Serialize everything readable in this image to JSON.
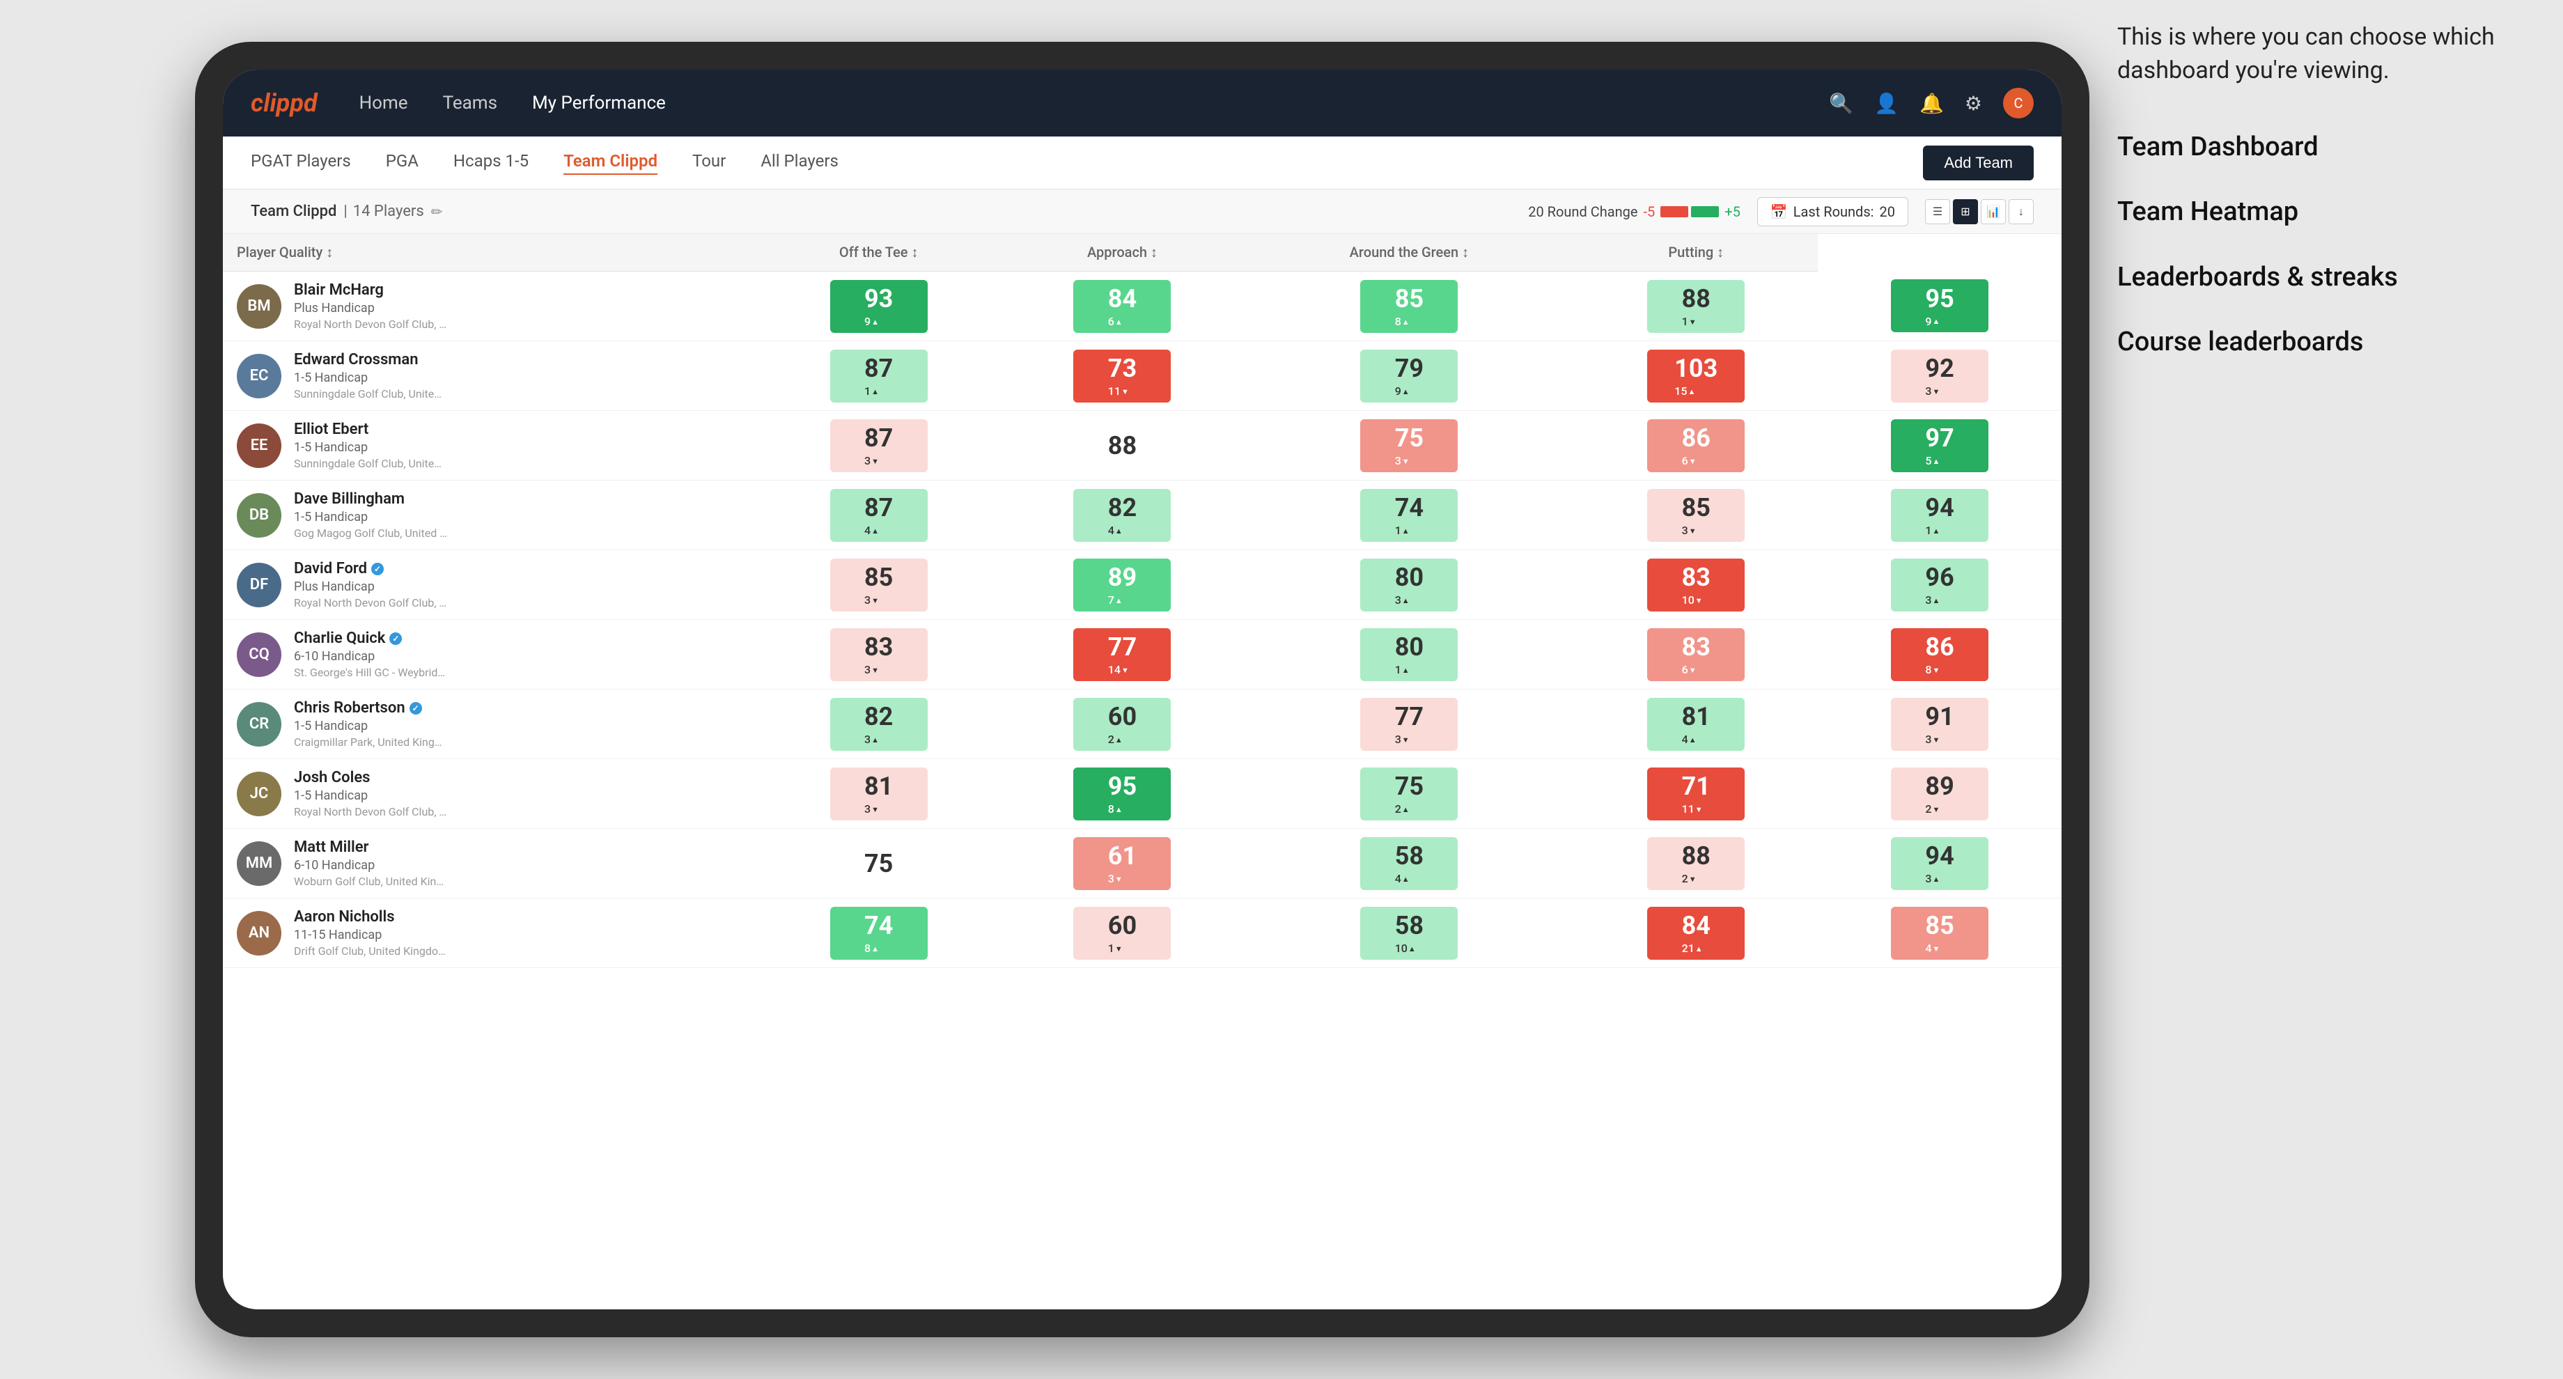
{
  "annotation": {
    "text": "This is where you can choose which dashboard you're viewing.",
    "items": [
      "Team Dashboard",
      "Team Heatmap",
      "Leaderboards & streaks",
      "Course leaderboards"
    ]
  },
  "nav": {
    "logo": "clippd",
    "links": [
      "Home",
      "Teams",
      "My Performance"
    ],
    "active_link": "My Performance",
    "icons": [
      "search",
      "user",
      "bell",
      "settings",
      "avatar"
    ]
  },
  "sub_nav": {
    "links": [
      "PGAT Players",
      "PGA",
      "Hcaps 1-5",
      "Team Clippd",
      "Tour",
      "All Players"
    ],
    "active": "Team Clippd",
    "add_button": "Add Team"
  },
  "team_header": {
    "name": "Team Clippd",
    "count": "14 Players",
    "round_change_label": "20 Round Change",
    "round_change_neg": "-5",
    "round_change_pos": "+5",
    "last_rounds_label": "Last Rounds:",
    "last_rounds_value": "20"
  },
  "table": {
    "columns": [
      "Player Quality ↕",
      "Off the Tee ↕",
      "Approach ↕",
      "Around the Green ↕",
      "Putting ↕"
    ],
    "player_col": "Player Quality",
    "rows": [
      {
        "name": "Blair McHarg",
        "handicap": "Plus Handicap",
        "club": "Royal North Devon Golf Club, United Kingdom",
        "avatar_color": "#7b6b4a",
        "initials": "BM",
        "stats": [
          {
            "value": "93",
            "change": "9",
            "dir": "up",
            "color": "green-dark"
          },
          {
            "value": "84",
            "change": "6",
            "dir": "up",
            "color": "green-mid"
          },
          {
            "value": "85",
            "change": "8",
            "dir": "up",
            "color": "green-mid"
          },
          {
            "value": "88",
            "change": "1",
            "dir": "down",
            "color": "green-light"
          },
          {
            "value": "95",
            "change": "9",
            "dir": "up",
            "color": "green-dark"
          }
        ]
      },
      {
        "name": "Edward Crossman",
        "handicap": "1-5 Handicap",
        "club": "Sunningdale Golf Club, United Kingdom",
        "avatar_color": "#5a7a9b",
        "initials": "EC",
        "stats": [
          {
            "value": "87",
            "change": "1",
            "dir": "up",
            "color": "green-light"
          },
          {
            "value": "73",
            "change": "11",
            "dir": "down",
            "color": "red-dark"
          },
          {
            "value": "79",
            "change": "9",
            "dir": "up",
            "color": "green-light"
          },
          {
            "value": "103",
            "change": "15",
            "dir": "up",
            "color": "red-dark"
          },
          {
            "value": "92",
            "change": "3",
            "dir": "down",
            "color": "red-light"
          }
        ]
      },
      {
        "name": "Elliot Ebert",
        "handicap": "1-5 Handicap",
        "club": "Sunningdale Golf Club, United Kingdom",
        "avatar_color": "#8b4a3a",
        "initials": "EE",
        "stats": [
          {
            "value": "87",
            "change": "3",
            "dir": "down",
            "color": "red-light"
          },
          {
            "value": "88",
            "change": "",
            "dir": "",
            "color": "neutral"
          },
          {
            "value": "75",
            "change": "3",
            "dir": "down",
            "color": "red-mid"
          },
          {
            "value": "86",
            "change": "6",
            "dir": "down",
            "color": "red-mid"
          },
          {
            "value": "97",
            "change": "5",
            "dir": "up",
            "color": "green-dark"
          }
        ]
      },
      {
        "name": "Dave Billingham",
        "handicap": "1-5 Handicap",
        "club": "Gog Magog Golf Club, United Kingdom",
        "avatar_color": "#6a8a5a",
        "initials": "DB",
        "stats": [
          {
            "value": "87",
            "change": "4",
            "dir": "up",
            "color": "green-light"
          },
          {
            "value": "82",
            "change": "4",
            "dir": "up",
            "color": "green-light"
          },
          {
            "value": "74",
            "change": "1",
            "dir": "up",
            "color": "green-light"
          },
          {
            "value": "85",
            "change": "3",
            "dir": "down",
            "color": "red-light"
          },
          {
            "value": "94",
            "change": "1",
            "dir": "up",
            "color": "green-light"
          }
        ]
      },
      {
        "name": "David Ford",
        "handicap": "Plus Handicap",
        "club": "Royal North Devon Golf Club, United Kingdom",
        "avatar_color": "#4a6a8a",
        "initials": "DF",
        "verified": true,
        "stats": [
          {
            "value": "85",
            "change": "3",
            "dir": "down",
            "color": "red-light"
          },
          {
            "value": "89",
            "change": "7",
            "dir": "up",
            "color": "green-mid"
          },
          {
            "value": "80",
            "change": "3",
            "dir": "up",
            "color": "green-light"
          },
          {
            "value": "83",
            "change": "10",
            "dir": "down",
            "color": "red-dark"
          },
          {
            "value": "96",
            "change": "3",
            "dir": "up",
            "color": "green-light"
          }
        ]
      },
      {
        "name": "Charlie Quick",
        "handicap": "6-10 Handicap",
        "club": "St. George's Hill GC - Weybridge - Surrey, Uni...",
        "avatar_color": "#7a5a8a",
        "initials": "CQ",
        "verified": true,
        "stats": [
          {
            "value": "83",
            "change": "3",
            "dir": "down",
            "color": "red-light"
          },
          {
            "value": "77",
            "change": "14",
            "dir": "down",
            "color": "red-dark"
          },
          {
            "value": "80",
            "change": "1",
            "dir": "up",
            "color": "green-light"
          },
          {
            "value": "83",
            "change": "6",
            "dir": "down",
            "color": "red-mid"
          },
          {
            "value": "86",
            "change": "8",
            "dir": "down",
            "color": "red-dark"
          }
        ]
      },
      {
        "name": "Chris Robertson",
        "handicap": "1-5 Handicap",
        "club": "Craigmillar Park, United Kingdom",
        "avatar_color": "#5a8a7a",
        "initials": "CR",
        "verified": true,
        "stats": [
          {
            "value": "82",
            "change": "3",
            "dir": "up",
            "color": "green-light"
          },
          {
            "value": "60",
            "change": "2",
            "dir": "up",
            "color": "green-light"
          },
          {
            "value": "77",
            "change": "3",
            "dir": "down",
            "color": "red-light"
          },
          {
            "value": "81",
            "change": "4",
            "dir": "up",
            "color": "green-light"
          },
          {
            "value": "91",
            "change": "3",
            "dir": "down",
            "color": "red-light"
          }
        ]
      },
      {
        "name": "Josh Coles",
        "handicap": "1-5 Handicap",
        "club": "Royal North Devon Golf Club, United Kingdom",
        "avatar_color": "#8a7a4a",
        "initials": "JC",
        "stats": [
          {
            "value": "81",
            "change": "3",
            "dir": "down",
            "color": "red-light"
          },
          {
            "value": "95",
            "change": "8",
            "dir": "up",
            "color": "green-dark"
          },
          {
            "value": "75",
            "change": "2",
            "dir": "up",
            "color": "green-light"
          },
          {
            "value": "71",
            "change": "11",
            "dir": "down",
            "color": "red-dark"
          },
          {
            "value": "89",
            "change": "2",
            "dir": "down",
            "color": "red-light"
          }
        ]
      },
      {
        "name": "Matt Miller",
        "handicap": "6-10 Handicap",
        "club": "Woburn Golf Club, United Kingdom",
        "avatar_color": "#6a6a6a",
        "initials": "MM",
        "stats": [
          {
            "value": "75",
            "change": "",
            "dir": "",
            "color": "neutral"
          },
          {
            "value": "61",
            "change": "3",
            "dir": "down",
            "color": "red-mid"
          },
          {
            "value": "58",
            "change": "4",
            "dir": "up",
            "color": "green-light"
          },
          {
            "value": "88",
            "change": "2",
            "dir": "down",
            "color": "red-light"
          },
          {
            "value": "94",
            "change": "3",
            "dir": "up",
            "color": "green-light"
          }
        ]
      },
      {
        "name": "Aaron Nicholls",
        "handicap": "11-15 Handicap",
        "club": "Drift Golf Club, United Kingdom",
        "avatar_color": "#9a6a4a",
        "initials": "AN",
        "stats": [
          {
            "value": "74",
            "change": "8",
            "dir": "up",
            "color": "green-mid"
          },
          {
            "value": "60",
            "change": "1",
            "dir": "down",
            "color": "red-light"
          },
          {
            "value": "58",
            "change": "10",
            "dir": "up",
            "color": "green-light"
          },
          {
            "value": "84",
            "change": "21",
            "dir": "up",
            "color": "red-dark"
          },
          {
            "value": "85",
            "change": "4",
            "dir": "down",
            "color": "red-mid"
          }
        ]
      }
    ]
  }
}
